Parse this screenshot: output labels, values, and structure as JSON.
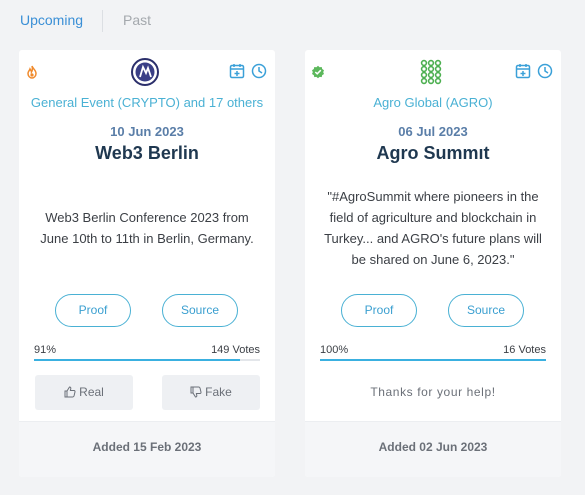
{
  "tabs": [
    {
      "label": "Upcoming",
      "active": true
    },
    {
      "label": "Past",
      "active": false
    }
  ],
  "cards": [
    {
      "status_icon": "fire-icon",
      "coin_logo": "crypto-logo",
      "coins": "General Event (CRYPTO) and 17 others",
      "date": "10 Jun 2023",
      "title": "Web3 Berlin",
      "description": "Web3 Berlin Conference 2023 from June 10th to 11th in Berlin, Germany.",
      "proof_label": "Proof",
      "source_label": "Source",
      "percent": "91%",
      "votes": "149 Votes",
      "vote_fraction": 0.91,
      "real_label": "Real",
      "fake_label": "Fake",
      "added": "Added 15 Feb 2023"
    },
    {
      "status_icon": "verified-check-icon",
      "coin_logo": "agro-logo",
      "coins": "Agro Global (AGRO)",
      "date": "06 Jul 2023",
      "title": "Agro Summıt",
      "description": "\"#AgroSummit where pioneers in the field of agriculture and blockchain in Turkey... and AGRO's future plans will be shared on June 6, 2023.\"",
      "proof_label": "Proof",
      "source_label": "Source",
      "percent": "100%",
      "votes": "16 Votes",
      "vote_fraction": 1.0,
      "thanks": "Thanks for your help!",
      "added": "Added 02 Jun 2023"
    }
  ],
  "colors": {
    "accent": "#3a8fd6",
    "link": "#4ab1d4",
    "bar": "#3ab0e0",
    "fire": "#f08a2c",
    "verified": "#5cb85c",
    "agro": "#4caf50"
  }
}
